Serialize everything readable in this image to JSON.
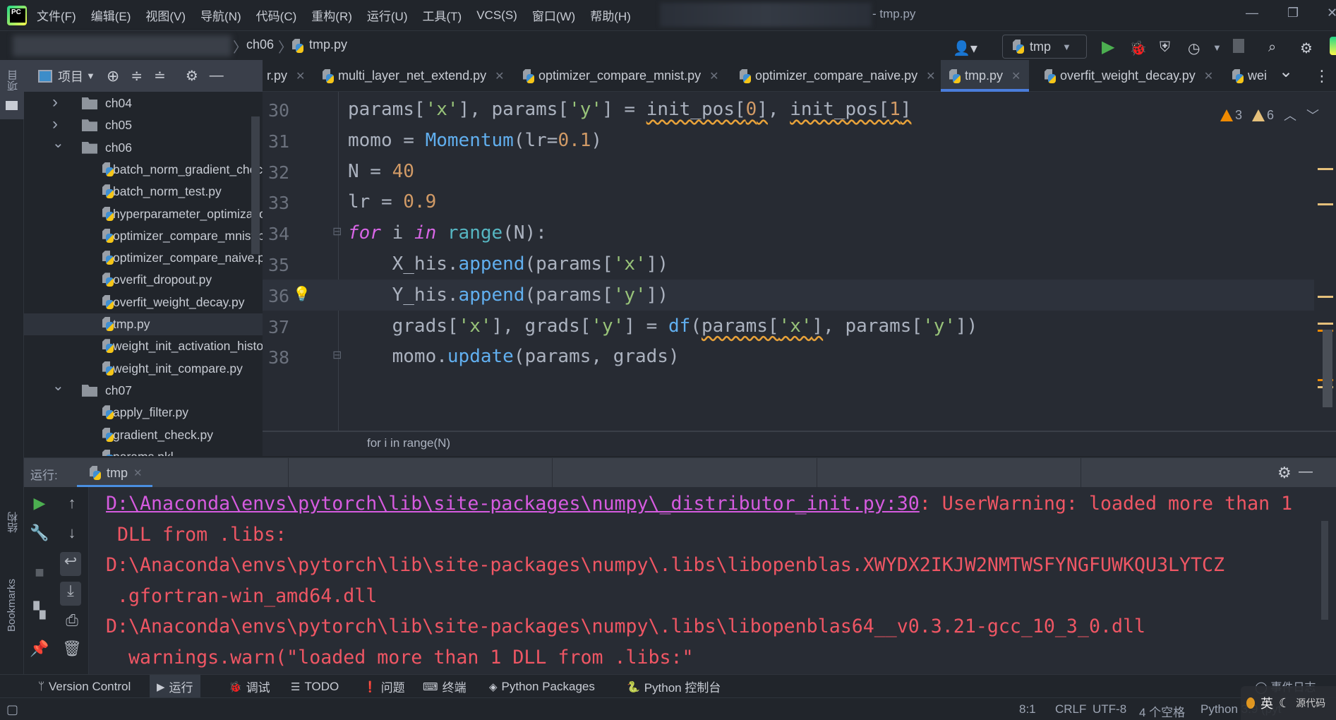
{
  "menu": [
    "文件(F)",
    "编辑(E)",
    "视图(V)",
    "导航(N)",
    "代码(C)",
    "重构(R)",
    "运行(U)",
    "工具(T)",
    "VCS(S)",
    "窗口(W)",
    "帮助(H)"
  ],
  "window_title": "- tmp.py",
  "breadcrumb": [
    "ch06",
    "tmp.py"
  ],
  "run_config": "tmp",
  "left_stripe": {
    "project": "项目",
    "structure": "结构",
    "bookmarks": "Bookmarks"
  },
  "project_panel": {
    "title": "项目",
    "tree": [
      {
        "label": "ch04",
        "type": "folder",
        "level": 0,
        "expanded": false
      },
      {
        "label": "ch05",
        "type": "folder",
        "level": 0,
        "expanded": false
      },
      {
        "label": "ch06",
        "type": "folder",
        "level": 0,
        "expanded": true
      },
      {
        "label": "batch_norm_gradient_check.py",
        "type": "file",
        "level": 1
      },
      {
        "label": "batch_norm_test.py",
        "type": "file",
        "level": 1
      },
      {
        "label": "hyperparameter_optimization.py",
        "type": "file",
        "level": 1
      },
      {
        "label": "optimizer_compare_mnist.py",
        "type": "file",
        "level": 1
      },
      {
        "label": "optimizer_compare_naive.py",
        "type": "file",
        "level": 1
      },
      {
        "label": "overfit_dropout.py",
        "type": "file",
        "level": 1
      },
      {
        "label": "overfit_weight_decay.py",
        "type": "file",
        "level": 1
      },
      {
        "label": "tmp.py",
        "type": "file",
        "level": 1,
        "selected": true
      },
      {
        "label": "weight_init_activation_histogram.py",
        "type": "file",
        "level": 1
      },
      {
        "label": "weight_init_compare.py",
        "type": "file",
        "level": 1
      },
      {
        "label": "ch07",
        "type": "folder",
        "level": 0,
        "expanded": true
      },
      {
        "label": "apply_filter.py",
        "type": "file",
        "level": 1
      },
      {
        "label": "gradient_check.py",
        "type": "file",
        "level": 1
      },
      {
        "label": "params.pkl",
        "type": "file",
        "level": 1
      }
    ]
  },
  "editor_tabs": [
    {
      "label": "r.py"
    },
    {
      "label": "multi_layer_net_extend.py"
    },
    {
      "label": "optimizer_compare_mnist.py"
    },
    {
      "label": "optimizer_compare_naive.py"
    },
    {
      "label": "tmp.py",
      "active": true
    },
    {
      "label": "overfit_weight_decay.py"
    },
    {
      "label": "wei"
    }
  ],
  "inspections": {
    "warnings": "3",
    "weak_warnings": "6"
  },
  "code": [
    {
      "n": "30",
      "tokens": [
        [
          "params[",
          ""
        ],
        [
          "'x'",
          "str"
        ],
        [
          "], params[",
          ""
        ],
        [
          "'y'",
          "str"
        ],
        [
          "] = ",
          ""
        ],
        [
          "init_pos[",
          "warn"
        ],
        [
          "0",
          "num warn"
        ],
        [
          "]",
          "warn"
        ],
        [
          ", ",
          ""
        ],
        [
          "init_pos[",
          "warn"
        ],
        [
          "1",
          "num warn"
        ],
        [
          "]",
          "warn"
        ]
      ]
    },
    {
      "n": "31",
      "tokens": [
        [
          "momo = ",
          ""
        ],
        [
          "Momentum",
          "fn"
        ],
        [
          "(lr=",
          ""
        ],
        [
          "0.1",
          "num"
        ],
        [
          ")",
          ""
        ]
      ]
    },
    {
      "n": "32",
      "tokens": [
        [
          "N = ",
          ""
        ],
        [
          "40",
          "num"
        ]
      ]
    },
    {
      "n": "33",
      "tokens": [
        [
          "lr = ",
          ""
        ],
        [
          "0.9",
          "num"
        ]
      ]
    },
    {
      "n": "34",
      "tokens": [
        [
          "for",
          "kw"
        ],
        [
          " i ",
          ""
        ],
        [
          "in",
          "kw"
        ],
        [
          " ",
          ""
        ],
        [
          "range",
          "bi"
        ],
        [
          "(N):",
          ""
        ]
      ]
    },
    {
      "n": "35",
      "tokens": [
        [
          "    X_his.",
          ""
        ],
        [
          "append",
          "fn"
        ],
        [
          "(params[",
          ""
        ],
        [
          "'x'",
          "str"
        ],
        [
          "])",
          ""
        ]
      ]
    },
    {
      "n": "36",
      "tokens": [
        [
          "    Y_his.",
          ""
        ],
        [
          "append",
          "fn"
        ],
        [
          "(params[",
          ""
        ],
        [
          "'y'",
          "str"
        ],
        [
          "])",
          ""
        ]
      ],
      "current": true
    },
    {
      "n": "37",
      "tokens": [
        [
          "    grads[",
          ""
        ],
        [
          "'x'",
          "str"
        ],
        [
          "], grads[",
          ""
        ],
        [
          "'y'",
          "str"
        ],
        [
          "] = ",
          ""
        ],
        [
          "df",
          "fn"
        ],
        [
          "(",
          ""
        ],
        [
          "params[",
          "warn"
        ],
        [
          "'x'",
          "str warn"
        ],
        [
          "]",
          "warn"
        ],
        [
          ", params[",
          ""
        ],
        [
          "'y'",
          "str"
        ],
        [
          "])",
          ""
        ]
      ]
    },
    {
      "n": "38",
      "tokens": [
        [
          "    momo.",
          ""
        ],
        [
          "update",
          "fn"
        ],
        [
          "(params, grads)",
          ""
        ]
      ]
    }
  ],
  "editor_breadcrumb": "for i in range(N)",
  "run_panel": {
    "label": "运行:",
    "tab": "tmp",
    "output": [
      [
        [
          "D:\\Anaconda\\envs\\pytorch\\lib\\site-packages\\numpy\\_distributor_init.py:30",
          "link"
        ],
        [
          ": UserWarning: loaded more than 1",
          ""
        ]
      ],
      [
        [
          " DLL from .libs:",
          ""
        ]
      ],
      [
        [
          "D:\\Anaconda\\envs\\pytorch\\lib\\site-packages\\numpy\\.libs\\libopenblas.XWYDX2IKJW2NMTWSFYNGFUWKQU3LYTCZ",
          ""
        ]
      ],
      [
        [
          " .gfortran-win_amd64.dll",
          ""
        ]
      ],
      [
        [
          "D:\\Anaconda\\envs\\pytorch\\lib\\site-packages\\numpy\\.libs\\libopenblas64__v0.3.21-gcc_10_3_0.dll",
          ""
        ]
      ],
      [
        [
          "  warnings.warn(\"loaded more than 1 DLL from .libs:\"",
          ""
        ]
      ]
    ]
  },
  "tool_tabs": [
    {
      "label": "Version Control",
      "icon": "branch-icon"
    },
    {
      "label": "运行",
      "icon": "run-icon",
      "active": true
    },
    {
      "label": "调试",
      "icon": "bug-icon"
    },
    {
      "label": "TODO",
      "icon": "list-icon"
    },
    {
      "label": "问题",
      "icon": "problem-icon"
    },
    {
      "label": "终端",
      "icon": "terminal-icon"
    },
    {
      "label": "Python Packages",
      "icon": "packages-icon"
    },
    {
      "label": "Python 控制台",
      "icon": "python-icon"
    }
  ],
  "event_log": "事件日志",
  "status": {
    "position": "8:1",
    "line_sep": "CRLF",
    "encoding": "UTF-8",
    "indent": "4 个空格",
    "interpreter": "Python 3.9 (pyt",
    "source": "源代码"
  },
  "ime": {
    "lang": "英"
  },
  "colors": {
    "accent": "#4a7ddb",
    "error_text": "#ef5664",
    "link": "#d65be0",
    "warning": "#f08a00"
  }
}
